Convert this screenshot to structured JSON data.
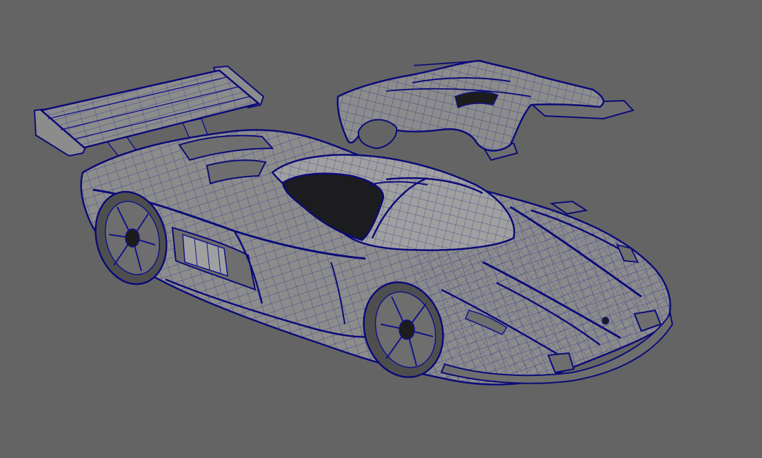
{
  "viewport": {
    "background_color": "#646464",
    "mesh_fill_color": "#8c8c8c",
    "mesh_fill_dark": "#6e6e6e",
    "mesh_fill_light": "#a0a0a0",
    "wire_color": "#12128c",
    "wire_heavy_color": "#0a0a78",
    "glass_color": "#1c1c1c",
    "tire_color": "#4e4e4e"
  },
  "scene": {
    "objects": [
      {
        "name": "car-body",
        "icon": "car-model"
      },
      {
        "name": "rear-wing",
        "icon": "wing-model"
      },
      {
        "name": "detached-rear-cover",
        "icon": "panel-model"
      },
      {
        "name": "front-wheel",
        "icon": "wheel-model"
      },
      {
        "name": "rear-wheel",
        "icon": "wheel-model"
      }
    ]
  }
}
